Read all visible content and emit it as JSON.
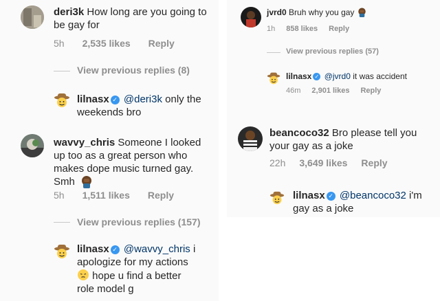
{
  "left": {
    "comment1": {
      "username": "deri3k",
      "text": "How long are you going to be gay for",
      "time": "5h",
      "likes": "2,535 likes",
      "reply": "Reply"
    },
    "view_previous_1": "View previous replies (8)",
    "reply1": {
      "username": "lilnasx",
      "mention": "@deri3k",
      "text": "only the weekends bro"
    },
    "comment2": {
      "username": "wavvy_chris",
      "text_line1": "Someone I looked",
      "text_line2": "up too as a great person who",
      "text_line3": "makes dope music turned gay.",
      "text_line4": "Smh",
      "time": "5h",
      "likes": "1,511 likes",
      "reply": "Reply"
    },
    "view_previous_2": "View previous replies (157)",
    "reply2": {
      "username": "lilnasx",
      "mention": "@wavvy_chris",
      "text_line1a": "i",
      "text_line2": "apologize for my actions",
      "text_line3": "hope u find a better",
      "text_line4": "role model g"
    }
  },
  "right": {
    "comment1": {
      "username": "jvrd0",
      "text": "Bruh why you gay",
      "time": "1h",
      "likes": "858 likes",
      "reply": "Reply"
    },
    "view_previous_1": "View previous replies (57)",
    "reply1": {
      "username": "lilnasx",
      "mention": "@jvrd0",
      "text": "it was accident",
      "time": "46m",
      "likes": "2,901 likes",
      "reply": "Reply"
    },
    "comment2": {
      "username": "beancoco32",
      "text_line1": "Bro please tell you",
      "text_line2": "your gay as a joke",
      "time": "22h",
      "likes": "3,649 likes",
      "reply": "Reply"
    },
    "reply2": {
      "username": "lilnasx",
      "mention": "@beancoco32",
      "text_line1b": "i'm",
      "text_line2": "gay as a joke"
    }
  },
  "colors": {
    "text": "#262626",
    "meta": "#8e8e8e",
    "mention": "#003569",
    "verified": "#3897f0"
  },
  "icons": [
    "verified-badge-icon",
    "cowboy-emoji-icon",
    "facepalm-emoji-icon",
    "pensive-emoji-icon"
  ]
}
